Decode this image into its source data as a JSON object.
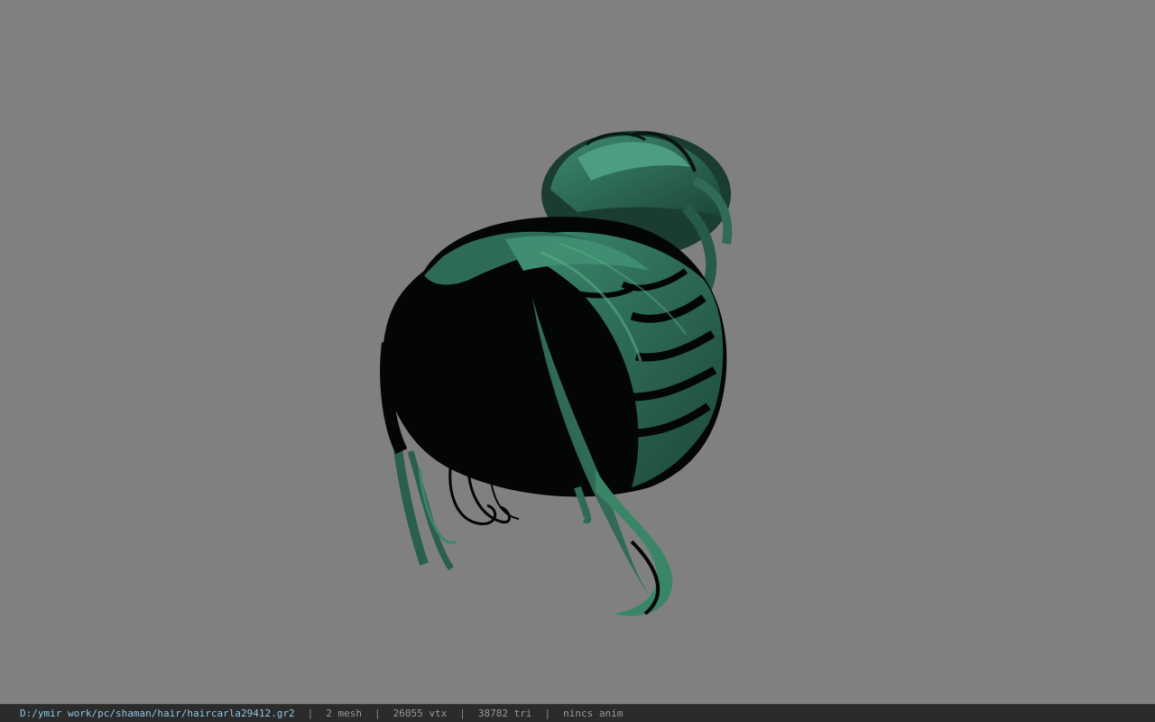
{
  "viewer": {
    "background_color": "#808080",
    "hair_color": "#2e6b55",
    "hair_shadow_color": "#050807"
  },
  "status_bar": {
    "file_path": "D:/ymir work/pc/shaman/hair/haircarla29412.gr2",
    "separator": "|",
    "mesh_count": "2 mesh",
    "vertex_count": "26055 vtx",
    "triangle_count": "38782 tri",
    "anim_status": "nincs anim"
  }
}
